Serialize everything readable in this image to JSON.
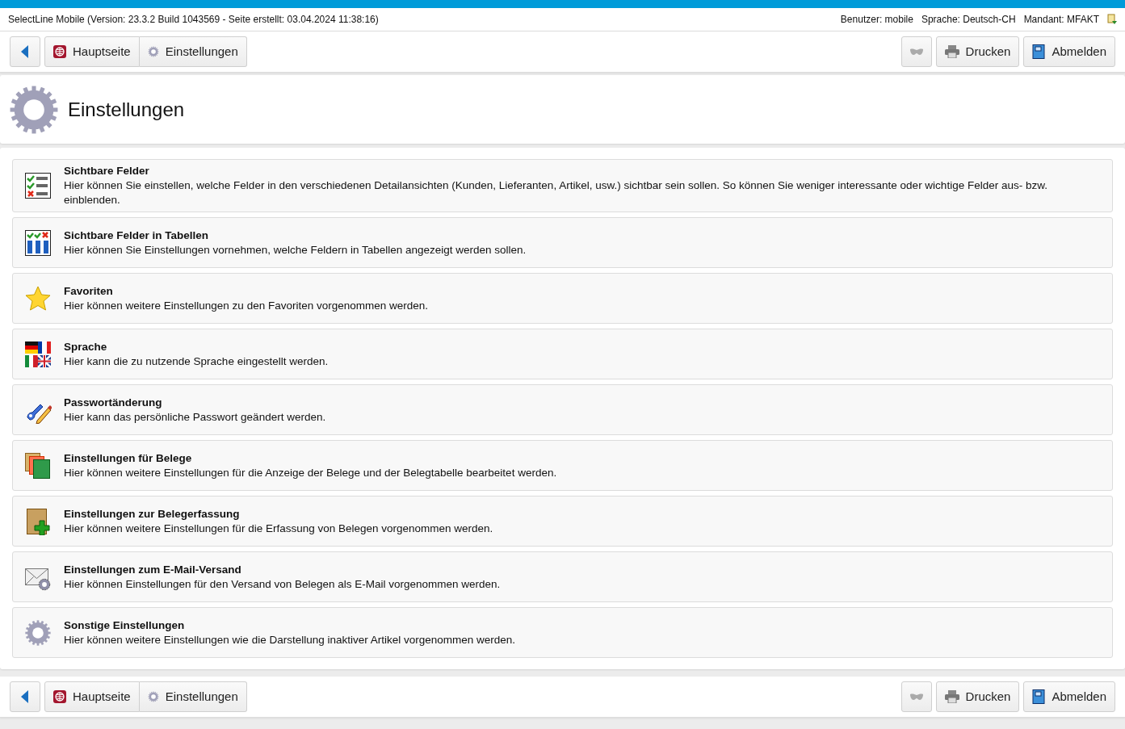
{
  "header": {
    "app_info": "SelectLine Mobile (Version: 23.3.2 Build 1043569 - Seite erstellt: 03.04.2024 11:38:16)",
    "user": "Benutzer: mobile",
    "language": "Sprache: Deutsch-CH",
    "client": "Mandant: MFAKT"
  },
  "top_toolbar": {
    "breadcrumbs": [
      {
        "label": "Hauptseite",
        "kind": "home"
      },
      {
        "label": "Einstellungen",
        "kind": "settings"
      }
    ],
    "buttons": [
      {
        "label": "Drucken",
        "kind": "print"
      },
      {
        "label": "Abmelden",
        "kind": "logout"
      }
    ]
  },
  "page_title": "Einstellungen",
  "items": [
    {
      "title": "Sichtbare Felder",
      "description": "Hier können Sie einstellen, welche Felder in den verschiedenen Detailansichten (Kunden, Lieferanten, Artikel, usw.) sichtbar sein sollen. So können Sie weniger interessante oder wichtige Felder aus- bzw. einblenden."
    },
    {
      "title": "Sichtbare Felder in Tabellen",
      "description": "Hier können Sie Einstellungen vornehmen, welche Feldern in Tabellen angezeigt werden sollen."
    },
    {
      "title": "Favoriten",
      "description": "Hier können weitere Einstellungen zu den Favoriten vorgenommen werden."
    },
    {
      "title": "Sprache",
      "description": "Hier kann die zu nutzende Sprache eingestellt werden."
    },
    {
      "title": "Passwortänderung",
      "description": "Hier kann das persönliche Passwort geändert werden."
    },
    {
      "title": "Einstellungen für Belege",
      "description": "Hier können weitere Einstellungen für die Anzeige der Belege und der Belegtabelle bearbeitet werden."
    },
    {
      "title": "Einstellungen zur Belegerfassung",
      "description": "Hier können weitere Einstellungen für die Erfassung von Belegen vorgenommen werden."
    },
    {
      "title": "Einstellungen zum E-Mail-Versand",
      "description": "Hier können Einstellungen für den Versand von Belegen als E-Mail vorgenommen werden."
    },
    {
      "title": "Sonstige Einstellungen",
      "description": "Hier können weitere Einstellungen wie die Darstellung inaktiver Artikel vorgenommen werden."
    }
  ],
  "bottom_toolbar": {
    "breadcrumbs": [
      {
        "label": "Hauptseite",
        "kind": "home"
      },
      {
        "label": "Einstellungen",
        "kind": "settings"
      }
    ],
    "buttons": [
      {
        "label": "Drucken",
        "kind": "print"
      },
      {
        "label": "Abmelden",
        "kind": "logout"
      }
    ]
  }
}
